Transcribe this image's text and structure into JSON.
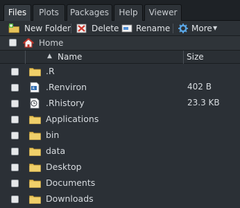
{
  "tabs": [
    {
      "label": "Files",
      "active": true
    },
    {
      "label": "Plots",
      "active": false
    },
    {
      "label": "Packages",
      "active": false
    },
    {
      "label": "Help",
      "active": false
    },
    {
      "label": "Viewer",
      "active": false
    }
  ],
  "toolbar": {
    "new_folder": "New Folder",
    "delete": "Delete",
    "rename": "Rename",
    "more": "More"
  },
  "breadcrumb": {
    "home": "Home"
  },
  "columns": {
    "name": "Name",
    "size": "Size",
    "sort_indicator": "▲"
  },
  "files": [
    {
      "name": ".R",
      "size": "",
      "icon": "folder-icon"
    },
    {
      "name": ".Renviron",
      "size": "402 B",
      "icon": "r-file-icon"
    },
    {
      "name": ".Rhistory",
      "size": "23.3 KB",
      "icon": "history-file-icon"
    },
    {
      "name": "Applications",
      "size": "",
      "icon": "folder-icon"
    },
    {
      "name": "bin",
      "size": "",
      "icon": "folder-icon"
    },
    {
      "name": "data",
      "size": "",
      "icon": "folder-icon"
    },
    {
      "name": "Desktop",
      "size": "",
      "icon": "folder-icon"
    },
    {
      "name": "Documents",
      "size": "",
      "icon": "folder-icon"
    },
    {
      "name": "Downloads",
      "size": "",
      "icon": "folder-icon"
    }
  ],
  "colors": {
    "background": "#2b3036",
    "folder": "#e7c35a",
    "accent": "#5aa7e6"
  }
}
